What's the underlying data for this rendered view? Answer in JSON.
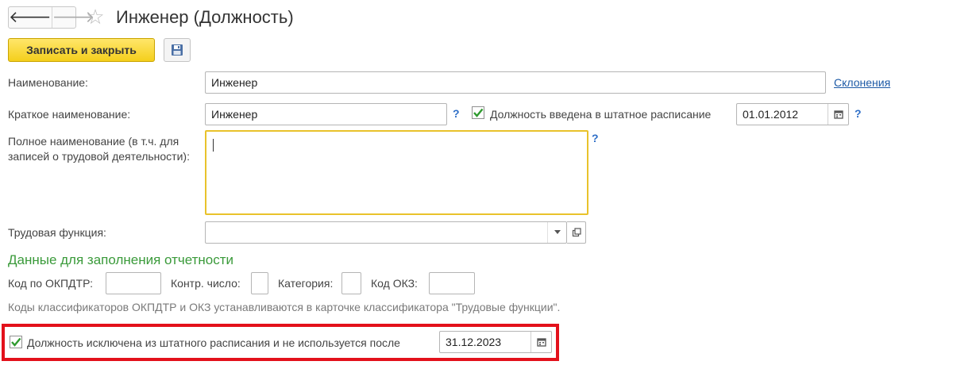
{
  "header": {
    "back_symbol": "🡐",
    "forward_symbol": "🡒",
    "favorite_symbol": "☆",
    "title": "Инженер (Должность)"
  },
  "toolbar": {
    "save_close_label": "Записать и закрыть"
  },
  "form": {
    "name": {
      "label": "Наименование:",
      "value": "Инженер"
    },
    "declensions_link": "Склонения",
    "short_name": {
      "label": "Краткое наименование:",
      "value": "Инженер"
    },
    "help_mark": "?",
    "in_staff": {
      "checked": true,
      "label": "Должность введена в штатное расписание",
      "date": "01.01.2012"
    },
    "full_name": {
      "label_line1": "Полное наименование (в т.ч. для",
      "label_line2": "записей о трудовой деятельности):",
      "value": ""
    },
    "labor_function": {
      "label": "Трудовая функция:",
      "value": ""
    }
  },
  "reporting": {
    "section_title": "Данные для заполнения отчетности",
    "okpdtr_label": "Код по ОКПДТР:",
    "okpdtr_value": "",
    "control_label": "Контр. число:",
    "control_value": "",
    "category_label": "Категория:",
    "category_value": "",
    "okz_label": "Код ОКЗ:",
    "okz_value": "",
    "hint": "Коды классификаторов ОКПДТР и ОКЗ устанавливаются в карточке классификатора \"Трудовые функции\"."
  },
  "excluded": {
    "checked": true,
    "label": "Должность исключена из штатного расписания и не используется после",
    "date": "31.12.2023"
  },
  "colors": {
    "primary_button": "#f4cf1c",
    "section_title": "#3a9a3a",
    "link": "#1d5aa6",
    "highlight_frame": "#e3111b",
    "focused_field_border": "#e9c22b"
  }
}
